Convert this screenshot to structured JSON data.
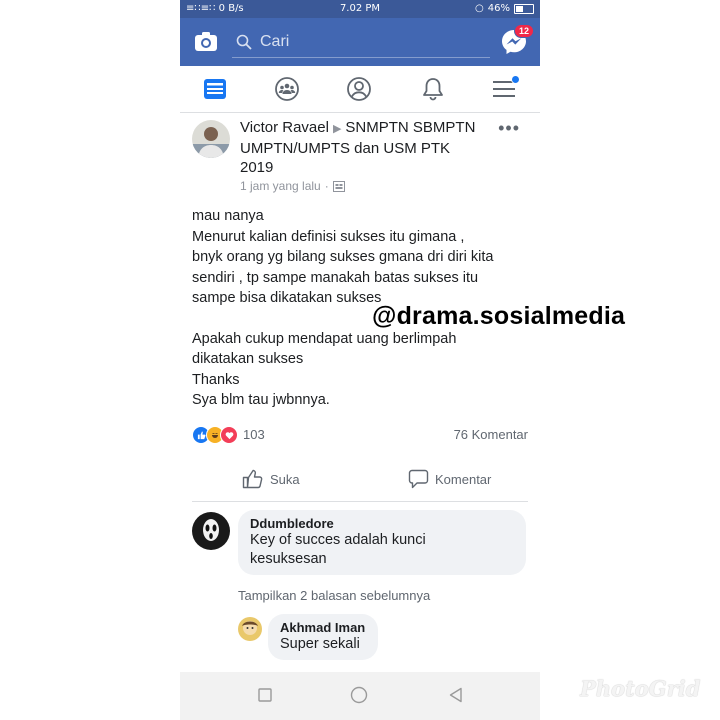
{
  "status_bar": {
    "left": "≡∷≡∷ 0 B/s",
    "time": "7.02 PM",
    "battery": "46%",
    "battery_level": 0.46
  },
  "top_bar": {
    "search_placeholder": "Cari",
    "messenger_badge": "12"
  },
  "nav_tabs": [
    "news-feed",
    "groups",
    "profile",
    "notifications",
    "menu"
  ],
  "post": {
    "author": "Victor Ravael",
    "group": "SNMPTN SBMPTN UMPTN/UMPTS dan USM PTK 2019",
    "time": "1 jam yang lalu",
    "body": [
      "mau nanya",
      "Menurut kalian definisi sukses itu gimana ,",
      "bnyk orang yg bilang sukses gmana dri diri kita",
      "sendiri , tp sampe manakah batas sukses itu",
      "sampe bisa dikatakan sukses",
      "",
      "Apakah cukup mendapat uang berlimpah",
      "dikatakan sukses",
      "Thanks",
      "Sya blm tau jwbnnya."
    ],
    "reaction_count": "103",
    "comment_count": "76 Komentar",
    "like_label": "Suka",
    "comment_label": "Komentar"
  },
  "overlay_tag": "@drama.sosialmedia",
  "comments": [
    {
      "name": "Ddumbledore",
      "text": [
        "Key of succes adalah kunci",
        "kesuksesan"
      ]
    },
    {
      "name": "Akhmad Iman",
      "text": [
        "Super sekali"
      ]
    }
  ],
  "prev_replies": "Tampilkan 2 balasan sebelumnya",
  "watermark": "PhotoGrid",
  "colors": {
    "header_blue": "#4267b2",
    "status_blue": "#3b5998",
    "like_blue": "#1877f2",
    "love_red": "#f33e58",
    "haha_yellow": "#f7b125"
  }
}
